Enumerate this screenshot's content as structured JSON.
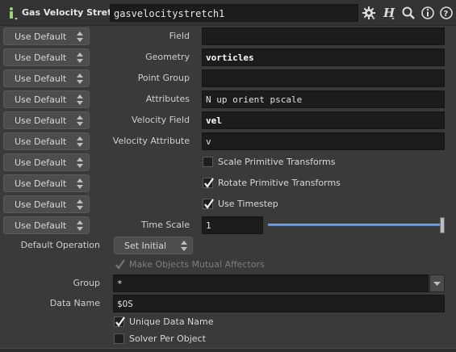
{
  "header": {
    "node_type": "Gas Velocity Stretch",
    "node_name": "gasvelocitystretch1",
    "icons": [
      "info-icon",
      "gear-icon",
      "help-h-icon",
      "search-icon",
      "info-circle-icon",
      "help-circle-icon"
    ]
  },
  "rows": [
    {
      "default": "Use Default",
      "label": "Field",
      "value": ""
    },
    {
      "default": "Use Default",
      "label": "Geometry",
      "value": "vorticles"
    },
    {
      "default": "Use Default",
      "label": "Point Group",
      "value": ""
    },
    {
      "default": "Use Default",
      "label": "Attributes",
      "value": "N up orient pscale"
    },
    {
      "default": "Use Default",
      "label": "Velocity Field",
      "value": "vel"
    },
    {
      "default": "Use Default",
      "label": "Velocity Attribute",
      "value": "v"
    },
    {
      "default": "Use Default",
      "label": "Scale Primitive Transforms",
      "checked": false
    },
    {
      "default": "Use Default",
      "label": "Rotate Primitive Transforms",
      "checked": true
    },
    {
      "default": "Use Default",
      "label": "Use Timestep",
      "checked": true
    },
    {
      "default": "Use Default",
      "label": "Time Scale",
      "value": "1",
      "slider_fraction": 1.0
    }
  ],
  "default_operation": {
    "label": "Default Operation",
    "value": "Set Initial"
  },
  "mutual_affectors": {
    "label": "Make Objects Mutual Affectors",
    "checked": true,
    "disabled": true
  },
  "group": {
    "label": "Group",
    "value": "*"
  },
  "data_name": {
    "label": "Data Name",
    "value": "$OS"
  },
  "unique_data_name": {
    "label": "Unique Data Name",
    "checked": true
  },
  "solver_per_object": {
    "label": "Solver Per Object",
    "checked": false
  },
  "colors": {
    "background": "#3a3a3a",
    "field": "#1c1c1c",
    "slider": "#6b8cc4"
  }
}
